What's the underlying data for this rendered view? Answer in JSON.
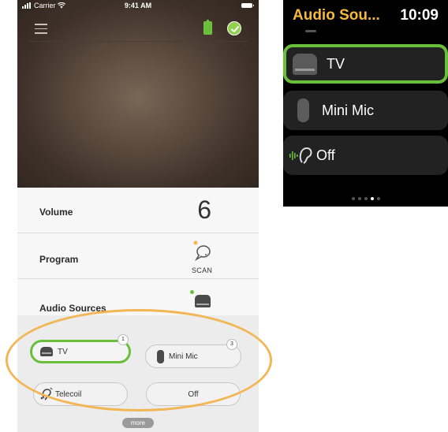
{
  "phone": {
    "status_bar": {
      "carrier": "Carrier",
      "time": "9:41 AM"
    },
    "icons": {
      "menu": "hamburger-icon",
      "battery": "battery-icon",
      "connected": "check-circle-icon"
    },
    "rows": {
      "volume": {
        "label": "Volume",
        "value": "6"
      },
      "program": {
        "label": "Program",
        "value": "SCAN"
      },
      "audio_sources": {
        "label": "Audio Sources",
        "value": "TV"
      }
    },
    "sources": [
      {
        "label": "TV",
        "badge": "1",
        "selected": true
      },
      {
        "label": "Mini Mic",
        "badge": "3",
        "selected": false
      },
      {
        "label": "Telecoil",
        "badge": "",
        "selected": false
      },
      {
        "label": "Off",
        "badge": "",
        "selected": false
      }
    ],
    "more_label": "more",
    "colors": {
      "selected": "#6abf3a",
      "highlight": "#f2b654"
    }
  },
  "watch": {
    "title": "Audio Sou...",
    "time": "10:09",
    "items": [
      {
        "label": "TV",
        "selected": true
      },
      {
        "label": "Mini Mic",
        "selected": false
      },
      {
        "label": "Off",
        "selected": false
      }
    ],
    "page_count": 5,
    "current_page": 4,
    "colors": {
      "title": "#f5b93c",
      "selected": "#6abf3a"
    }
  }
}
